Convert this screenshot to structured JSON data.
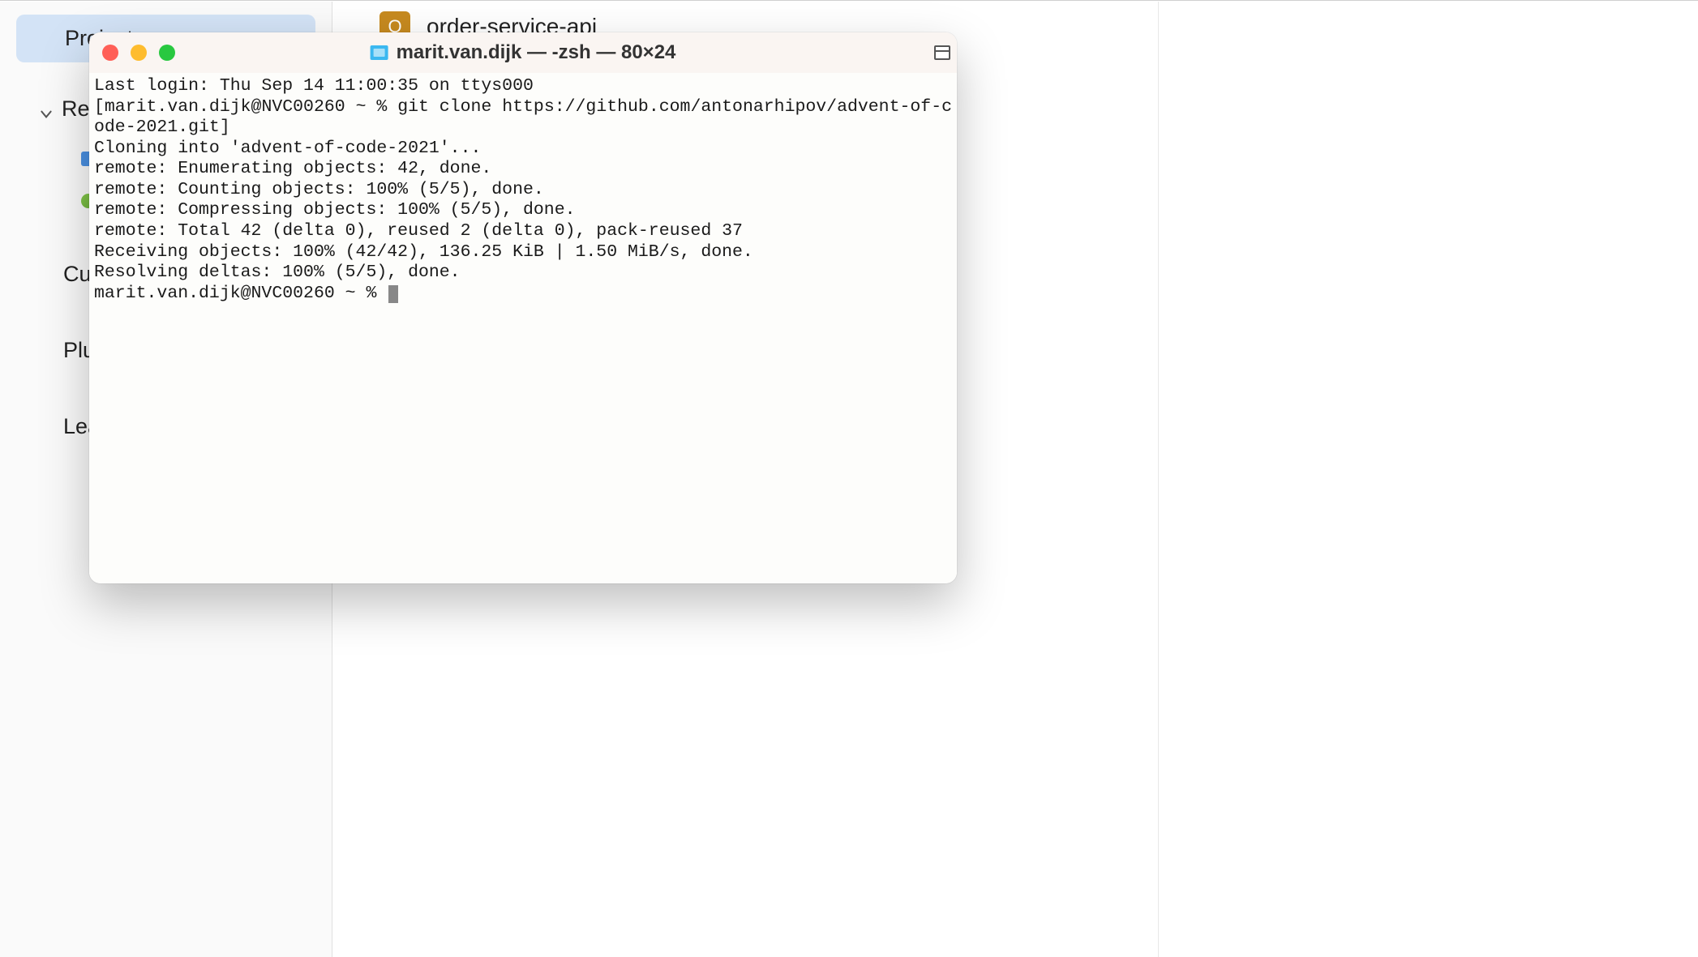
{
  "ide": {
    "sidebar": {
      "items": [
        {
          "label": "Projects",
          "selected": true
        },
        {
          "label": "Rem",
          "expandable": true,
          "expanded": true
        },
        {
          "label": "Cust",
          "plain": true
        },
        {
          "label": "Plug",
          "plain": true
        },
        {
          "label": "Lear",
          "plain": true
        }
      ]
    },
    "main": {
      "project": {
        "icon_letter": "O",
        "name": "order-service-api"
      }
    }
  },
  "terminal": {
    "title": "marit.van.dijk — -zsh — 80×24",
    "last_login_line": "Last login: Thu Sep 14 11:00:35 on ttys000",
    "prompt_prefix_bracket": "[",
    "prompt_user_host": "marit.van.dijk@NVC00260",
    "prompt_path": "~",
    "prompt_symbol": "%",
    "command": "git clone https://github.com/antonarhipov/advent-of-code-2021.git",
    "output_lines": [
      "Cloning into 'advent-of-code-2021'...",
      "remote: Enumerating objects: 42, done.",
      "remote: Counting objects: 100% (5/5), done.",
      "remote: Compressing objects: 100% (5/5), done.",
      "remote: Total 42 (delta 0), reused 2 (delta 0), pack-reused 37",
      "Receiving objects: 100% (42/42), 136.25 KiB | 1.50 MiB/s, done.",
      "Resolving deltas: 100% (5/5), done."
    ],
    "prompt2": "marit.van.dijk@NVC00260 ~ % "
  }
}
